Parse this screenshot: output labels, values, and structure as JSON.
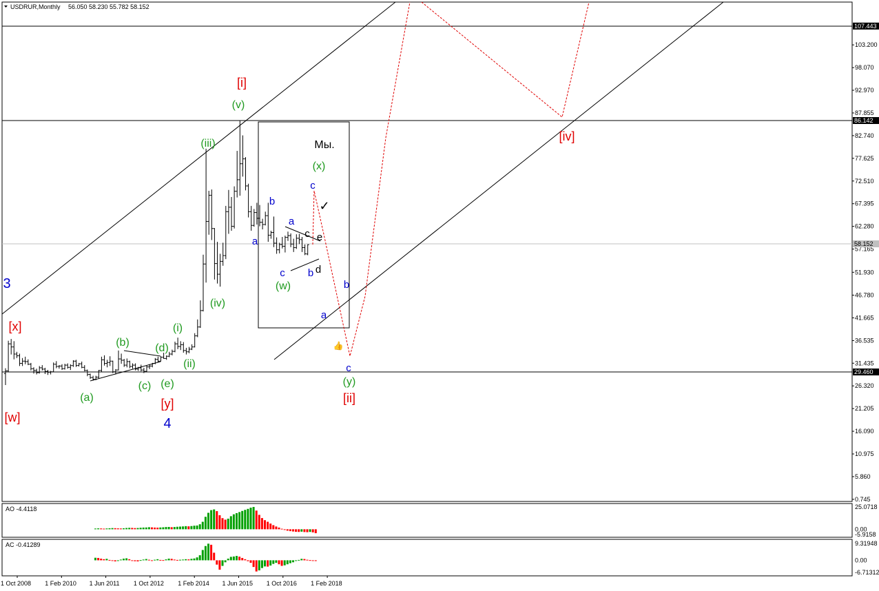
{
  "header": {
    "symbol": "USDRUR,Monthly",
    "ohlc": "56.050 58.230 55.782 58.152"
  },
  "chart_data": [
    {
      "type": "candlestick",
      "panel": "main",
      "price_axis_labels": [
        "103.200",
        "98.070",
        "92.970",
        "87.855",
        "82.740",
        "77.625",
        "72.510",
        "67.395",
        "62.280",
        "57.165",
        "51.930",
        "46.780",
        "41.665",
        "36.535",
        "31.435",
        "26.320",
        "21.205",
        "16.090",
        "10.975",
        "5.860",
        "0.745"
      ],
      "levels": [
        {
          "value": 107.443,
          "label": "107.443",
          "style": "line"
        },
        {
          "value": 86.142,
          "label": "86.142",
          "style": "line"
        },
        {
          "value": 58.152,
          "label": "58.152",
          "style": "current"
        },
        {
          "value": 29.46,
          "label": "29.460",
          "style": "line"
        }
      ],
      "ylim": [
        0.745,
        110
      ],
      "time_axis_labels": [
        "1 Oct 2008",
        "1 Feb 2010",
        "1 Jun 2011",
        "1 Oct 2012",
        "1 Feb 2014",
        "1 Jun 2015",
        "1 Oct 2016",
        "1 Feb 2018"
      ],
      "bars": [
        [
          29.1,
          30.3,
          26.5,
          29.7
        ],
        [
          29.7,
          36.5,
          29.5,
          35.8
        ],
        [
          35.8,
          36.9,
          33.4,
          35.1
        ],
        [
          35.1,
          36.4,
          32.3,
          33.5
        ],
        [
          33.5,
          34.0,
          32.6,
          33.1
        ],
        [
          33.1,
          33.6,
          30.8,
          31.4
        ],
        [
          31.4,
          32.6,
          30.8,
          31.9
        ],
        [
          31.9,
          32.9,
          31.2,
          31.8
        ],
        [
          31.8,
          32.3,
          31.0,
          31.2
        ],
        [
          31.2,
          31.5,
          29.8,
          30.2
        ],
        [
          30.2,
          30.5,
          29.1,
          29.8
        ],
        [
          29.8,
          30.2,
          28.9,
          29.3
        ],
        [
          29.3,
          30.8,
          29.1,
          30.4
        ],
        [
          30.4,
          31.0,
          29.8,
          30.1
        ],
        [
          30.1,
          30.4,
          29.0,
          29.6
        ],
        [
          29.6,
          29.9,
          28.8,
          29.4
        ],
        [
          29.4,
          29.7,
          28.9,
          29.5
        ],
        [
          29.5,
          31.6,
          29.4,
          31.2
        ],
        [
          31.2,
          31.9,
          30.3,
          30.7
        ],
        [
          30.7,
          31.0,
          30.2,
          30.8
        ],
        [
          30.8,
          31.2,
          29.9,
          30.2
        ],
        [
          30.2,
          31.3,
          30.0,
          31.0
        ],
        [
          31.0,
          31.4,
          30.2,
          30.5
        ],
        [
          30.5,
          31.2,
          29.9,
          30.9
        ],
        [
          30.9,
          32.1,
          30.6,
          31.9
        ],
        [
          31.9,
          32.2,
          30.6,
          30.9
        ],
        [
          30.9,
          31.5,
          30.7,
          31.3
        ],
        [
          31.3,
          31.8,
          30.3,
          30.5
        ],
        [
          30.5,
          31.0,
          29.6,
          29.8
        ],
        [
          29.8,
          30.0,
          28.5,
          28.9
        ],
        [
          28.9,
          29.1,
          27.9,
          28.2
        ],
        [
          28.2,
          28.6,
          27.5,
          27.8
        ],
        [
          27.8,
          28.6,
          27.6,
          28.3
        ],
        [
          28.3,
          29.9,
          28.0,
          29.8
        ],
        [
          29.8,
          32.9,
          29.5,
          32.2
        ],
        [
          32.2,
          33.2,
          30.9,
          31.4
        ],
        [
          31.4,
          32.2,
          30.5,
          31.6
        ],
        [
          31.6,
          33.0,
          30.8,
          31.9
        ],
        [
          31.9,
          32.0,
          29.2,
          29.5
        ],
        [
          29.5,
          30.1,
          28.9,
          29.9
        ],
        [
          29.9,
          34.3,
          29.8,
          32.4
        ],
        [
          32.4,
          33.6,
          31.3,
          32.1
        ],
        [
          32.1,
          32.4,
          30.6,
          31.0
        ],
        [
          31.0,
          32.5,
          30.5,
          31.8
        ],
        [
          31.8,
          32.0,
          30.3,
          30.7
        ],
        [
          30.7,
          31.4,
          30.2,
          31.0
        ],
        [
          31.0,
          31.4,
          29.8,
          30.1
        ],
        [
          30.1,
          30.6,
          29.7,
          30.4
        ],
        [
          30.4,
          31.1,
          29.6,
          29.9
        ],
        [
          29.9,
          30.4,
          29.2,
          29.6
        ],
        [
          29.6,
          31.0,
          29.5,
          30.6
        ],
        [
          30.6,
          31.2,
          30.1,
          30.8
        ],
        [
          30.8,
          31.5,
          30.5,
          31.4
        ],
        [
          31.4,
          32.6,
          31.2,
          32.3
        ],
        [
          32.3,
          32.9,
          31.6,
          31.9
        ],
        [
          31.9,
          33.0,
          31.8,
          32.8
        ],
        [
          32.8,
          33.8,
          32.4,
          32.5
        ],
        [
          32.5,
          33.2,
          32.2,
          33.0
        ],
        [
          33.0,
          34.0,
          32.8,
          33.5
        ],
        [
          33.5,
          34.5,
          33.2,
          34.1
        ],
        [
          34.1,
          36.3,
          33.9,
          35.8
        ],
        [
          35.8,
          37.2,
          34.6,
          35.2
        ],
        [
          35.2,
          36.4,
          34.4,
          35.6
        ],
        [
          35.6,
          36.2,
          33.8,
          34.3
        ],
        [
          34.3,
          34.9,
          33.4,
          34.0
        ],
        [
          34.0,
          35.1,
          33.7,
          34.6
        ],
        [
          34.6,
          35.7,
          34.4,
          35.1
        ],
        [
          35.1,
          38.2,
          35.0,
          37.6
        ],
        [
          37.6,
          41.3,
          37.3,
          39.6
        ],
        [
          39.6,
          45.6,
          39.4,
          43.3
        ],
        [
          43.3,
          55.9,
          43.1,
          53.8
        ],
        [
          53.8,
          79.8,
          49.6,
          63.4
        ],
        [
          63.4,
          70.3,
          60.4,
          69.3
        ],
        [
          69.3,
          70.6,
          59.2,
          61.8
        ],
        [
          61.8,
          61.9,
          50.3,
          53.9
        ],
        [
          53.9,
          58.8,
          49.4,
          51.5
        ],
        [
          51.5,
          56.1,
          48.7,
          54.4
        ],
        [
          54.4,
          58.6,
          53.4,
          55.7
        ],
        [
          55.7,
          66.9,
          54.9,
          65.6
        ],
        [
          65.6,
          70.5,
          60.6,
          66.6
        ],
        [
          66.6,
          68.9,
          61.3,
          62.3
        ],
        [
          62.3,
          71.3,
          61.8,
          70.2
        ],
        [
          70.2,
          79.3,
          68.8,
          72.8
        ],
        [
          72.8,
          86.2,
          69.2,
          76.4
        ],
        [
          76.4,
          82.8,
          73.5,
          77.5
        ],
        [
          77.5,
          77.9,
          70.4,
          71.4
        ],
        [
          71.4,
          71.9,
          64.3,
          65.6
        ],
        [
          65.6,
          66.9,
          61.3,
          62.5
        ],
        [
          62.5,
          66.2,
          62.2,
          65.4
        ],
        [
          65.4,
          67.6,
          62.7,
          64.1
        ],
        [
          64.1,
          67.1,
          62.3,
          63.2
        ],
        [
          63.2,
          64.0,
          61.6,
          62.7
        ],
        [
          62.7,
          65.6,
          62.5,
          64.7
        ],
        [
          64.7,
          67.6,
          58.8,
          60.3
        ],
        [
          60.3,
          61.3,
          59.5,
          60.9
        ],
        [
          60.9,
          64.5,
          57.6,
          58.5
        ],
        [
          58.5,
          59.8,
          56.1,
          57.0
        ],
        [
          57.0,
          58.6,
          56.2,
          58.2
        ],
        [
          58.2,
          59.9,
          57.3,
          57.8
        ],
        [
          57.8,
          60.2,
          56.4,
          59.8
        ],
        [
          59.8,
          61.1,
          59.0,
          60.2
        ],
        [
          60.2,
          60.7,
          57.6,
          58.3
        ],
        [
          58.3,
          59.5,
          56.5,
          57.5
        ],
        [
          57.5,
          60.5,
          57.2,
          59.6
        ],
        [
          59.6,
          60.6,
          58.3,
          59.3
        ],
        [
          59.3,
          59.9,
          56.5,
          57.5
        ],
        [
          57.5,
          58.2,
          55.8,
          56.1
        ],
        [
          56.05,
          58.23,
          55.78,
          58.152
        ]
      ],
      "bar_colors": {
        "up": "#000000",
        "down": "#000000"
      }
    },
    {
      "type": "bar",
      "panel": "AO",
      "indicator": "AO -4.4118",
      "axis_labels": [
        "25.0718",
        "0.00",
        "-5.9158"
      ],
      "ylim": [
        -5.9158,
        25.0718
      ],
      "values": [
        0.8,
        1.0,
        0.9,
        0.7,
        0.9,
        1.1,
        1.3,
        1.2,
        1.0,
        0.9,
        1.1,
        1.4,
        1.6,
        1.5,
        1.3,
        1.4,
        1.7,
        1.9,
        2.0,
        2.3,
        2.1,
        1.9,
        1.8,
        2.0,
        2.2,
        2.5,
        2.6,
        2.3,
        2.5,
        2.8,
        3.0,
        3.2,
        3.5,
        3.3,
        3.6,
        4.0,
        4.2,
        5.6,
        8.4,
        14.0,
        18.5,
        21.5,
        22.3,
        20.4,
        15.8,
        12.5,
        10.8,
        11.9,
        14.7,
        16.8,
        18.1,
        19.3,
        20.6,
        21.8,
        22.9,
        24.3,
        25.1,
        21.0,
        16.2,
        12.6,
        10.2,
        8.4,
        6.4,
        4.6,
        3.1,
        1.9,
        0.6,
        -0.8,
        -1.6,
        -2.1,
        -2.5,
        -2.9,
        -3.0,
        -2.7,
        -3.1,
        -3.3,
        -3.0,
        -3.5,
        -4.4118
      ],
      "color_up": "#00a000",
      "color_down": "#ff0000"
    },
    {
      "type": "bar",
      "panel": "AC",
      "indicator": "AC -0.41289",
      "axis_labels": [
        "9.31948",
        "0.00",
        "-6.71312"
      ],
      "ylim": [
        -6.71312,
        9.31948
      ],
      "values": [
        1.4,
        1.3,
        0.9,
        0.6,
        0.8,
        0.2,
        -0.3,
        -0.6,
        -0.4,
        0.4,
        0.9,
        1.1,
        0.6,
        -0.1,
        -0.5,
        -0.6,
        0.1,
        0.4,
        0.7,
        0.3,
        -0.2,
        0.3,
        0.6,
        0.2,
        0.1,
        0.5,
        0.9,
        0.8,
        0.4,
        0.2,
        0.3,
        0.4,
        0.6,
        0.5,
        0.8,
        1.0,
        1.6,
        2.8,
        5.7,
        7.9,
        9.2,
        8.6,
        4.2,
        -2.4,
        -5.2,
        -3.1,
        -1.1,
        0.9,
        1.9,
        2.1,
        2.4,
        2.0,
        1.3,
        0.6,
        -0.5,
        -1.4,
        -3.7,
        -6.2,
        -5.6,
        -4.3,
        -3.4,
        -3.5,
        -2.9,
        -2.0,
        -1.4,
        -2.2,
        -3.1,
        -2.8,
        -2.2,
        -1.6,
        -1.1,
        -0.4,
        0.2,
        0.8,
        0.7,
        0.3,
        0.1,
        -0.2,
        -0.41289
      ],
      "color_up": "#00a000",
      "color_down": "#ff0000"
    }
  ],
  "annotations": {
    "labels": [
      {
        "text": "[x]",
        "color": "#e00000",
        "size": 18
      },
      {
        "text": "[w]",
        "color": "#e00000",
        "size": 18
      },
      {
        "text": "3",
        "color": "#0000cc",
        "size": 20
      },
      {
        "text": "(a)",
        "color": "#1f9a1f",
        "size": 16
      },
      {
        "text": "(b)",
        "color": "#1f9a1f",
        "size": 16
      },
      {
        "text": "(c)",
        "color": "#1f9a1f",
        "size": 16
      },
      {
        "text": "(d)",
        "color": "#1f9a1f",
        "size": 16
      },
      {
        "text": "(e)",
        "color": "#1f9a1f",
        "size": 16
      },
      {
        "text": "[y]",
        "color": "#e00000",
        "size": 18
      },
      {
        "text": "4",
        "color": "#0000cc",
        "size": 20
      },
      {
        "text": "(i)",
        "color": "#1f9a1f",
        "size": 16
      },
      {
        "text": "(ii)",
        "color": "#1f9a1f",
        "size": 16
      },
      {
        "text": "(iii)",
        "color": "#1f9a1f",
        "size": 16
      },
      {
        "text": "(iv)",
        "color": "#1f9a1f",
        "size": 16
      },
      {
        "text": "(v)",
        "color": "#1f9a1f",
        "size": 16
      },
      {
        "text": "[i]",
        "color": "#e00000",
        "size": 18
      },
      {
        "text": "Мы.",
        "color": "#000000",
        "size": 16
      },
      {
        "text": "(x)",
        "color": "#1f9a1f",
        "size": 16
      },
      {
        "text": "c",
        "color": "#0000cc",
        "size": 15
      },
      {
        "text": "b",
        "color": "#0000cc",
        "size": 15
      },
      {
        "text": "a",
        "color": "#0000cc",
        "size": 15
      },
      {
        "text": "a",
        "color": "#0000cc",
        "size": 15
      },
      {
        "text": "c",
        "color": "#000000",
        "size": 15
      },
      {
        "text": "e",
        "color": "#000000",
        "size": 15
      },
      {
        "text": "d",
        "color": "#000000",
        "size": 15
      },
      {
        "text": "c",
        "color": "#0000cc",
        "size": 15
      },
      {
        "text": "b",
        "color": "#0000cc",
        "size": 15
      },
      {
        "text": "(w)",
        "color": "#1f9a1f",
        "size": 16
      },
      {
        "text": "b",
        "color": "#0000cc",
        "size": 15
      },
      {
        "text": "a",
        "color": "#0000cc",
        "size": 15
      },
      {
        "text": "c",
        "color": "#0000cc",
        "size": 15
      },
      {
        "text": "(y)",
        "color": "#1f9a1f",
        "size": 16
      },
      {
        "text": "[ii]",
        "color": "#e00000",
        "size": 18
      },
      {
        "text": "[iv]",
        "color": "#e00000",
        "size": 18
      },
      {
        "text": "✓",
        "color": "#000000",
        "size": 18
      },
      {
        "text": "👍",
        "color": "#555555",
        "size": 12
      }
    ],
    "forecast_color": "#e00000",
    "channel_color": "#000000"
  }
}
